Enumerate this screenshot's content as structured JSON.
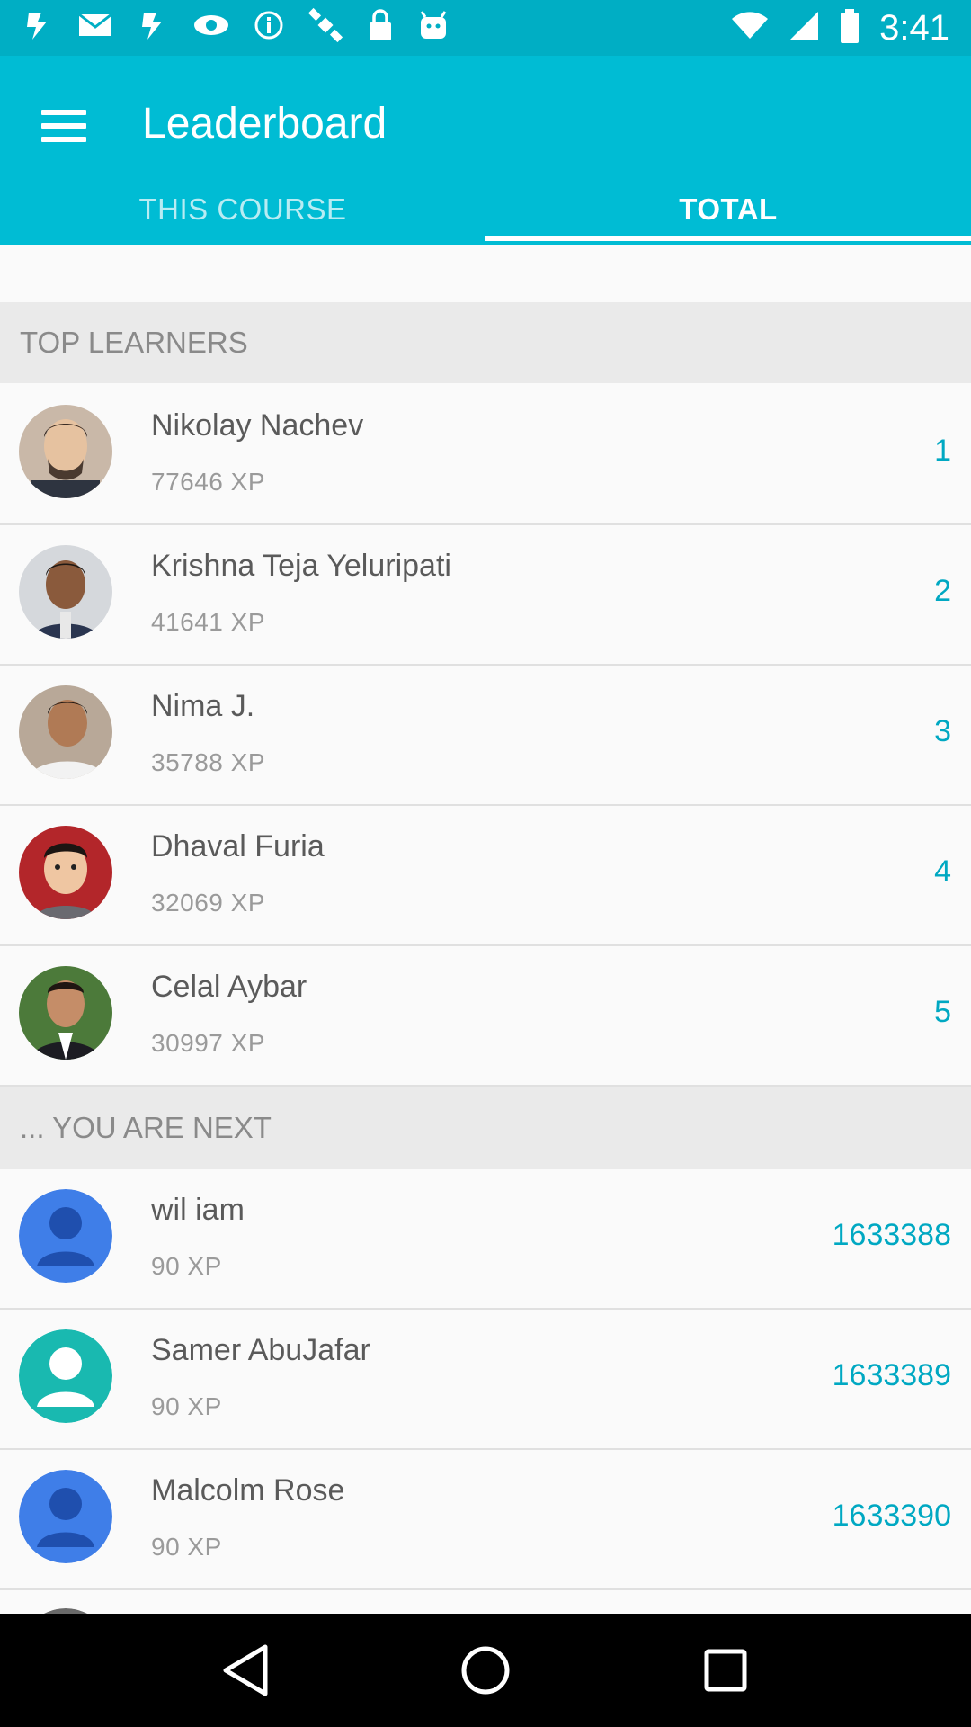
{
  "status_bar": {
    "time": "3:41",
    "icons": [
      "app-icon",
      "mail-icon",
      "app-icon",
      "eye-icon",
      "info-icon",
      "satellite-icon",
      "lock-icon",
      "android-icon"
    ],
    "right_icons": [
      "wifi-icon",
      "signal-icon",
      "battery-icon"
    ]
  },
  "app_bar": {
    "title": "Leaderboard",
    "tabs": [
      {
        "label": "THIS COURSE",
        "active": false
      },
      {
        "label": "TOTAL",
        "active": true
      }
    ]
  },
  "sections": {
    "top_header": "TOP LEARNERS",
    "next_header": "... YOU ARE NEXT"
  },
  "top_learners": [
    {
      "name": "Nikolay Nachev",
      "xp": "77646 XP",
      "rank": "1"
    },
    {
      "name": "Krishna Teja Yeluripati",
      "xp": "41641 XP",
      "rank": "2"
    },
    {
      "name": "Nima J.",
      "xp": "35788 XP",
      "rank": "3"
    },
    {
      "name": "Dhaval Furia",
      "xp": "32069 XP",
      "rank": "4"
    },
    {
      "name": "Celal Aybar",
      "xp": "30997 XP",
      "rank": "5"
    }
  ],
  "next_learners": [
    {
      "name": "wil iam",
      "xp": "90 XP",
      "rank": "1633388"
    },
    {
      "name": "Samer AbuJafar",
      "xp": "90 XP",
      "rank": "1633389"
    },
    {
      "name": "Malcolm Rose",
      "xp": "90 XP",
      "rank": "1633390"
    }
  ],
  "colors": {
    "primary": "#00bcd4",
    "status": "#00aec4",
    "accent_text": "#00a8c2",
    "placeholder_avatar": "#3f7ee8",
    "placeholder_avatar_alt": "#19b9b0"
  },
  "nav_bar": [
    "back-icon",
    "home-icon",
    "recents-icon"
  ]
}
